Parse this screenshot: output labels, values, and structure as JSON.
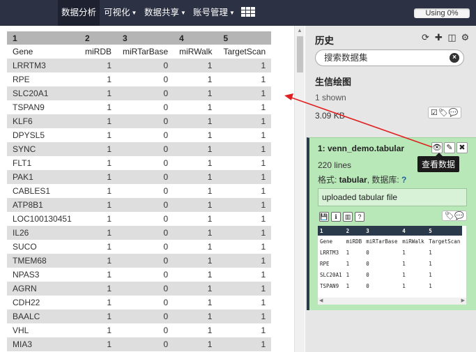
{
  "masthead": {
    "nav": [
      {
        "label": "数据分析",
        "active": true,
        "dropdown": false
      },
      {
        "label": "可视化",
        "active": false,
        "dropdown": true
      },
      {
        "label": "数据共享",
        "active": false,
        "dropdown": true
      },
      {
        "label": "账号管理",
        "active": false,
        "dropdown": true
      }
    ],
    "apps_icon": "grid-icon",
    "usage": "Using 0%"
  },
  "table": {
    "index_row": [
      "1",
      "2",
      "3",
      "4",
      "5"
    ],
    "header_row": [
      "Gene",
      "miRDB",
      "miRTarBase",
      "miRWalk",
      "TargetScan"
    ],
    "rows": [
      [
        "LRRTM3",
        "1",
        "0",
        "1",
        "1"
      ],
      [
        "RPE",
        "1",
        "0",
        "1",
        "1"
      ],
      [
        "SLC20A1",
        "1",
        "0",
        "1",
        "1"
      ],
      [
        "TSPAN9",
        "1",
        "0",
        "1",
        "1"
      ],
      [
        "KLF6",
        "1",
        "0",
        "1",
        "1"
      ],
      [
        "DPYSL5",
        "1",
        "0",
        "1",
        "1"
      ],
      [
        "SYNC",
        "1",
        "0",
        "1",
        "1"
      ],
      [
        "FLT1",
        "1",
        "0",
        "1",
        "1"
      ],
      [
        "PAK1",
        "1",
        "0",
        "1",
        "1"
      ],
      [
        "CABLES1",
        "1",
        "0",
        "1",
        "1"
      ],
      [
        "ATP8B1",
        "1",
        "0",
        "1",
        "1"
      ],
      [
        "LOC100130451",
        "1",
        "0",
        "1",
        "1"
      ],
      [
        "IL26",
        "1",
        "0",
        "1",
        "1"
      ],
      [
        "SUCO",
        "1",
        "0",
        "1",
        "1"
      ],
      [
        "TMEM68",
        "1",
        "0",
        "1",
        "1"
      ],
      [
        "NPAS3",
        "1",
        "0",
        "1",
        "1"
      ],
      [
        "AGRN",
        "1",
        "0",
        "1",
        "1"
      ],
      [
        "CDH22",
        "1",
        "0",
        "1",
        "1"
      ],
      [
        "BAALC",
        "1",
        "0",
        "1",
        "1"
      ],
      [
        "VHL",
        "1",
        "0",
        "1",
        "1"
      ],
      [
        "MIA3",
        "1",
        "0",
        "1",
        "1"
      ]
    ]
  },
  "history": {
    "title": "历史",
    "search_placeholder": "搜索数据集",
    "name": "生信绘图",
    "shown": "1 shown",
    "size": "3.09 KB"
  },
  "dataset": {
    "title": "1: venn_demo.tabular",
    "tooltip": "查看数据",
    "lines": "220 lines",
    "format_label": "格式: ",
    "format_value": "tabular",
    "db_label": ", 数据库: ",
    "db_value": "?",
    "info": "uploaded tabular file",
    "peek": {
      "index": [
        "1",
        "2",
        "3",
        "4",
        "5"
      ],
      "rows": [
        [
          "Gene",
          "miRDB",
          "miRTarBase",
          "miRWalk",
          "TargetScan"
        ],
        [
          "LRRTM3",
          "1",
          "0",
          "1",
          "1"
        ],
        [
          "RPE",
          "1",
          "0",
          "1",
          "1"
        ],
        [
          "SLC20A1",
          "1",
          "0",
          "1",
          "1"
        ],
        [
          "TSPAN9",
          "1",
          "0",
          "1",
          "1"
        ]
      ]
    }
  },
  "colors": {
    "masthead": "#2c3143",
    "dataset_ok": "#b8e8b8",
    "annotation": "#e02020"
  }
}
